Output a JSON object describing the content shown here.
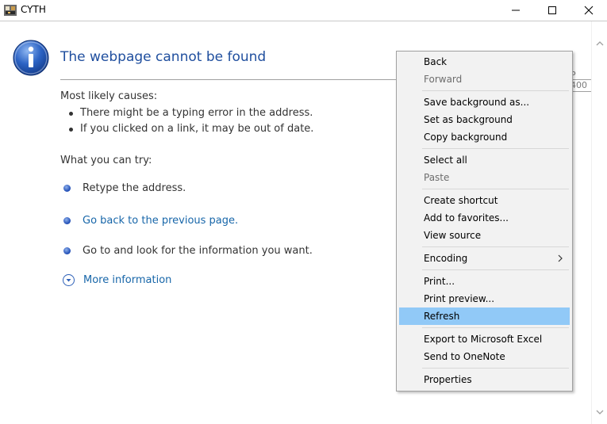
{
  "window": {
    "title": "CYTH"
  },
  "page": {
    "heading": "The webpage cannot be found",
    "partial_code": "P 400",
    "causes_label": "Most likely causes:",
    "causes": [
      "There might be a typing error in the address.",
      "If you clicked on a link, it may be out of date."
    ],
    "try_label": "What you can try:",
    "try_items": [
      "Retype the address.",
      "Go back to the previous page.",
      "Go to  and look for the information you want."
    ],
    "more_info": "More information"
  },
  "context_menu": {
    "items": [
      {
        "label": "Back",
        "enabled": true
      },
      {
        "label": "Forward",
        "enabled": false
      },
      {
        "label": "Save background as...",
        "enabled": true
      },
      {
        "label": "Set as background",
        "enabled": true
      },
      {
        "label": "Copy background",
        "enabled": true
      },
      {
        "label": "Select all",
        "enabled": true
      },
      {
        "label": "Paste",
        "enabled": false
      },
      {
        "label": "Create shortcut",
        "enabled": true
      },
      {
        "label": "Add to favorites...",
        "enabled": true
      },
      {
        "label": "View source",
        "enabled": true
      },
      {
        "label": "Encoding",
        "enabled": true,
        "submenu": true
      },
      {
        "label": "Print...",
        "enabled": true
      },
      {
        "label": "Print preview...",
        "enabled": true
      },
      {
        "label": "Refresh",
        "enabled": true,
        "highlighted": true
      },
      {
        "label": "Export to Microsoft Excel",
        "enabled": true
      },
      {
        "label": "Send to OneNote",
        "enabled": true
      },
      {
        "label": "Properties",
        "enabled": true
      }
    ]
  },
  "colors": {
    "heading": "#1f4e9e",
    "link": "#1766a9",
    "menu_highlight": "#91c9f7",
    "menu_background": "#f2f2f2"
  },
  "icons": {
    "app": "app-icon",
    "info": "info-icon",
    "minimize": "minimize-icon",
    "maximize": "maximize-icon",
    "close": "close-icon",
    "more_info": "chevron-down-circle-icon",
    "submenu": "chevron-right-icon"
  }
}
